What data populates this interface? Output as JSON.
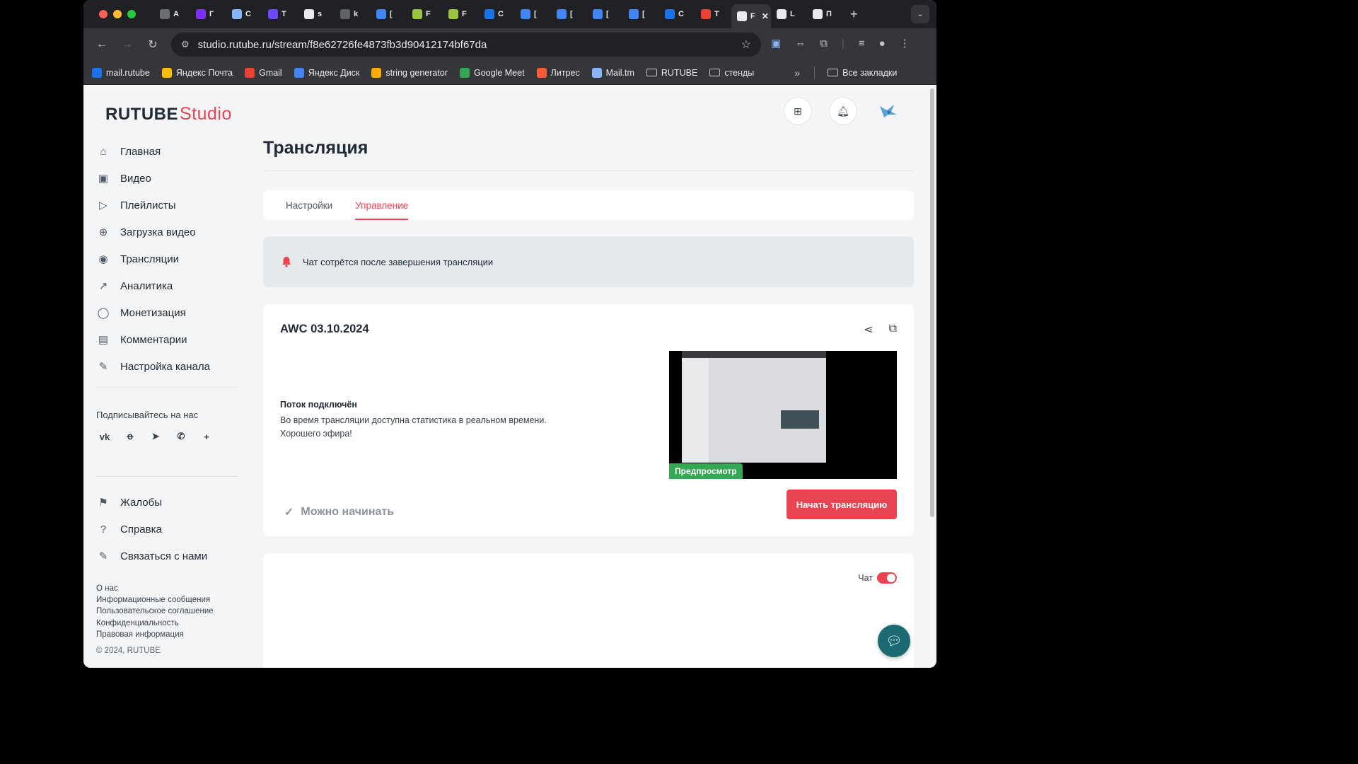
{
  "browser": {
    "tabs": [
      {
        "label": "A",
        "color": "#6b6e73"
      },
      {
        "label": "Г",
        "color": "#7b2ff7"
      },
      {
        "label": "С",
        "color": "#8ab4f8"
      },
      {
        "label": "Т",
        "color": "#6b47ff"
      },
      {
        "label": "s",
        "color": "#e8eaed"
      },
      {
        "label": "k",
        "color": "#5f6368"
      },
      {
        "label": "[",
        "color": "#4285f4"
      },
      {
        "label": "F",
        "color": "#9bc53d"
      },
      {
        "label": "F",
        "color": "#9bc53d"
      },
      {
        "label": "С",
        "color": "#1a73e8"
      },
      {
        "label": "[",
        "color": "#4285f4"
      },
      {
        "label": "[",
        "color": "#4285f4"
      },
      {
        "label": "[",
        "color": "#4285f4"
      },
      {
        "label": "[",
        "color": "#4285f4"
      },
      {
        "label": "С",
        "color": "#1a73e8"
      },
      {
        "label": "Т",
        "color": "#ea4335"
      }
    ],
    "active_tab": {
      "label": "F",
      "close": "✕"
    },
    "after_tabs": [
      {
        "label": "L",
        "color": "#e8eaed"
      },
      {
        "label": "П",
        "color": "#e8eaed"
      }
    ],
    "new_tab": "+",
    "tab_menu": "⌄",
    "url": "studio.rutube.ru/stream/f8e62726fe4873fb3d90412174bf67da",
    "bookmarks": [
      {
        "label": "mail.rutube",
        "color": "#1a73e8"
      },
      {
        "label": "Яндекс Почта",
        "color": "#fbbc05"
      },
      {
        "label": "Gmail",
        "color": "#ea4335"
      },
      {
        "label": "Яндекс Диск",
        "color": "#4285f4"
      },
      {
        "label": "string generator",
        "color": "#f9ab00"
      },
      {
        "label": "Google Meet",
        "color": "#34a853"
      },
      {
        "label": "Литрес",
        "color": "#ff5c35"
      },
      {
        "label": "Mail.tm",
        "color": "#8ab4f8"
      },
      {
        "label": "RUTUBE",
        "folder": true
      },
      {
        "label": "стенды",
        "folder": true
      }
    ],
    "more": "»",
    "all_bookmarks": "Все закладки"
  },
  "logo": {
    "main": "RUTUBE",
    "studio": "Studio"
  },
  "sidebar": {
    "items": [
      {
        "label": "Главная",
        "icon": "home-icon",
        "glyph": "⌂"
      },
      {
        "label": "Видео",
        "icon": "video-icon",
        "glyph": "▣"
      },
      {
        "label": "Плейлисты",
        "icon": "playlist-icon",
        "glyph": "▷"
      },
      {
        "label": "Загрузка видео",
        "icon": "upload-icon",
        "glyph": "⊕"
      },
      {
        "label": "Трансляции",
        "icon": "broadcast-icon",
        "glyph": "◉"
      },
      {
        "label": "Аналитика",
        "icon": "analytics-icon",
        "glyph": "↗"
      },
      {
        "label": "Монетизация",
        "icon": "coin-icon",
        "glyph": "◯"
      },
      {
        "label": "Комментарии",
        "icon": "comment-icon",
        "glyph": "▤"
      },
      {
        "label": "Настройка канала",
        "icon": "wand-icon",
        "glyph": "✎"
      }
    ],
    "subscribe_label": "Подписывайтесь на нас",
    "socials": [
      {
        "name": "vk-icon",
        "glyph": "vk"
      },
      {
        "name": "ok-icon",
        "glyph": "ꝋ"
      },
      {
        "name": "telegram-icon",
        "glyph": "➤"
      },
      {
        "name": "viber-icon",
        "glyph": "✆"
      },
      {
        "name": "plus-icon",
        "glyph": "+"
      }
    ],
    "items2": [
      {
        "label": "Жалобы",
        "icon": "flag-icon",
        "glyph": "⚑"
      },
      {
        "label": "Справка",
        "icon": "help-icon",
        "glyph": "?"
      },
      {
        "label": "Связаться с нами",
        "icon": "contact-icon",
        "glyph": "✎"
      }
    ],
    "footer_links": [
      "О нас",
      "Информационные сообщения",
      "Пользовательское соглашение",
      "Конфиденциальность",
      "Правовая информация"
    ],
    "copyright": "© 2024, RUTUBE"
  },
  "page": {
    "title": "Трансляция",
    "tabs": [
      "Настройки",
      "Управление"
    ],
    "alert": "Чат сотрётся после завершения трансляции",
    "stream": {
      "title": "AWC 03.10.2024",
      "status_head": "Поток подключён",
      "status_line1": "Во время трансляции доступна статистика в реальном времени.",
      "status_line2": "Хорошего эфира!",
      "preview_badge": "Предпросмотр",
      "ready": "Можно начинать",
      "start_button": "Начать трансляцию"
    },
    "chat_label": "Чат",
    "chat_enabled": true
  },
  "colors": {
    "accent": "#e84452",
    "success": "#34a853",
    "fab": "#1c6b74"
  }
}
